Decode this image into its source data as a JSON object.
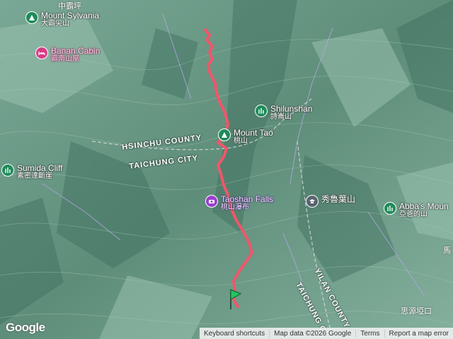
{
  "map": {
    "pois": [
      {
        "id": "mount-sylvania",
        "en": "Mount Sylvania",
        "zh": "大霸尖山",
        "icon": "mountain-icon",
        "style": "green"
      },
      {
        "id": "banan-cabin",
        "en": "Banan Cabin",
        "zh": "霸南山屋",
        "icon": "bed-icon",
        "style": "pink"
      },
      {
        "id": "shilunshan",
        "en": "Shilunshan",
        "zh": "詩崙山",
        "icon": "peak-icon",
        "style": "green"
      },
      {
        "id": "mount-tao",
        "en": "Mount Tao",
        "zh": "桃山",
        "icon": "mountain-icon",
        "style": "green"
      },
      {
        "id": "sumida-cliff",
        "en": "Sumida Cliff",
        "zh": "素密達斷崖",
        "icon": "peak-icon",
        "style": "green"
      },
      {
        "id": "taoshan-falls",
        "en": "Taoshan Falls",
        "zh": "桃山瀑布",
        "icon": "camera-icon",
        "style": "purple"
      },
      {
        "id": "xiuluye",
        "en": "",
        "zh": "秀魯葉山",
        "icon": "school-icon",
        "style": "grey"
      },
      {
        "id": "abbas-mountain",
        "en": "Abba's Moun",
        "zh": "亞爸的山",
        "icon": "peak-icon",
        "style": "green"
      }
    ],
    "top_label": "中霸坪",
    "region_labels": [
      {
        "id": "hsinchu-county",
        "text": "HSINCHU COUNTY"
      },
      {
        "id": "taichung-city",
        "text": "TAICHUNG CITY"
      },
      {
        "id": "yilan-county",
        "text": "YILAN COUNTY"
      },
      {
        "id": "taichung-c",
        "text": "TAICHUNG C"
      }
    ],
    "edge_labels": [
      {
        "id": "ma-label",
        "text": "馬"
      },
      {
        "id": "siyuan-label",
        "text": "思源埡口"
      }
    ],
    "colors": {
      "route": "#f0566a",
      "terrain": "#6f9e8a",
      "ridge": "#3f6e5e",
      "start_marker": "#22c55e"
    }
  },
  "footer": {
    "logo": "Google",
    "keyboard": "Keyboard shortcuts",
    "mapdata": "Map data ©2026 Google",
    "terms": "Terms",
    "report": "Report a map error"
  }
}
